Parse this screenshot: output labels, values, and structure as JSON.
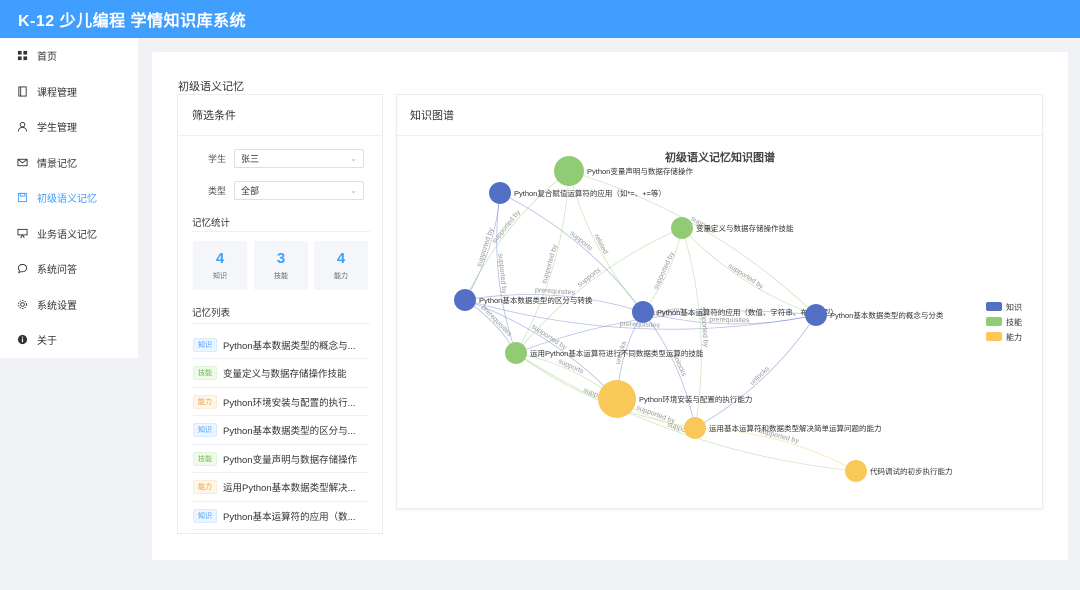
{
  "app": {
    "title": "K-12 少儿编程 学情知识库系统"
  },
  "sidebar": {
    "items": [
      {
        "label": "首页",
        "icon": "grid-icon"
      },
      {
        "label": "课程管理",
        "icon": "book-icon"
      },
      {
        "label": "学生管理",
        "icon": "user-icon"
      },
      {
        "label": "情景记忆",
        "icon": "mail-icon"
      },
      {
        "label": "初级语义记忆",
        "icon": "save-icon",
        "active": true
      },
      {
        "label": "业务语义记忆",
        "icon": "presentation-icon"
      },
      {
        "label": "系统问答",
        "icon": "chat-icon"
      },
      {
        "label": "系统设置",
        "icon": "gear-icon"
      },
      {
        "label": "关于",
        "icon": "info-icon"
      }
    ]
  },
  "page": {
    "title": "初级语义记忆"
  },
  "filter": {
    "header": "筛选条件",
    "student_label": "学生",
    "student_value": "张三",
    "type_label": "类型",
    "type_value": "全部",
    "stats_title": "记忆统计",
    "stats": [
      {
        "value": "4",
        "label": "知识"
      },
      {
        "value": "3",
        "label": "技能"
      },
      {
        "value": "4",
        "label": "能力"
      }
    ],
    "list_title": "记忆列表",
    "list": [
      {
        "tag": "知识",
        "kind": "k",
        "text": "Python基本数据类型的概念与..."
      },
      {
        "tag": "技能",
        "kind": "s",
        "text": "变量定义与数据存储操作技能"
      },
      {
        "tag": "能力",
        "kind": "a",
        "text": "Python环境安装与配置的执行..."
      },
      {
        "tag": "知识",
        "kind": "k",
        "text": "Python基本数据类型的区分与..."
      },
      {
        "tag": "技能",
        "kind": "s",
        "text": "Python变量声明与数据存储操作"
      },
      {
        "tag": "能力",
        "kind": "a",
        "text": "运用Python基本数据类型解决..."
      },
      {
        "tag": "知识",
        "kind": "k",
        "text": "Python基本运算符的应用（数..."
      }
    ]
  },
  "graph": {
    "header": "知识图谱",
    "title": "初级语义记忆知识图谱",
    "legend": [
      {
        "name": "知识",
        "color": "#5470c6"
      },
      {
        "name": "技能",
        "color": "#91cc75"
      },
      {
        "name": "能力",
        "color": "#fac858"
      }
    ],
    "nodes": [
      {
        "id": "n1",
        "label": "Python变量声明与数据存储操作",
        "cat": "技能"
      },
      {
        "id": "n2",
        "label": "Python复合赋值运算符的应用（如*=、+=等）",
        "cat": "知识"
      },
      {
        "id": "n3",
        "label": "变量定义与数据存储操作技能",
        "cat": "技能"
      },
      {
        "id": "n4",
        "label": "Python基本数据类型的区分与转换",
        "cat": "知识"
      },
      {
        "id": "n5",
        "label": "Python基本运算符的应用（数值、字符串、布尔类型）",
        "cat": "知识"
      },
      {
        "id": "n6",
        "label": "Python基本数据类型的概念与分类",
        "cat": "知识"
      },
      {
        "id": "n7",
        "label": "运用Python基本运算符进行不同数据类型运算的技能",
        "cat": "技能"
      },
      {
        "id": "n8",
        "label": "Python环境安装与配置的执行能力",
        "cat": "能力"
      },
      {
        "id": "n9",
        "label": "运用基本运算符和数据类型解决简单运算问题的能力",
        "cat": "能力"
      },
      {
        "id": "n10",
        "label": "代码调试的初步执行能力",
        "cat": "能力"
      }
    ],
    "edges": [
      {
        "s": "n2",
        "t": "n4",
        "label": "supported by"
      },
      {
        "s": "n2",
        "t": "n7",
        "label": "supported by"
      },
      {
        "s": "n2",
        "t": "n5",
        "label": "supports"
      },
      {
        "s": "n1",
        "t": "n5",
        "label": "related"
      },
      {
        "s": "n1",
        "t": "n7",
        "label": "supported by"
      },
      {
        "s": "n1",
        "t": "n4",
        "label": "supported by"
      },
      {
        "s": "n1",
        "t": "n6",
        "label": "supports"
      },
      {
        "s": "n3",
        "t": "n6",
        "label": "supported by"
      },
      {
        "s": "n3",
        "t": "n5",
        "label": "supported by"
      },
      {
        "s": "n3",
        "t": "n7",
        "label": "supports"
      },
      {
        "s": "n4",
        "t": "n5",
        "label": "prerequisites"
      },
      {
        "s": "n4",
        "t": "n6",
        "label": "prerequisites"
      },
      {
        "s": "n4",
        "t": "n7",
        "label": "prerequisites"
      },
      {
        "s": "n5",
        "t": "n6",
        "label": "prerequisites"
      },
      {
        "s": "n5",
        "t": "n9",
        "label": "unlocks"
      },
      {
        "s": "n5",
        "t": "n8",
        "label": "unlocks"
      },
      {
        "s": "n6",
        "t": "n9",
        "label": "unlocks"
      },
      {
        "s": "n6",
        "t": "n7",
        "label": "prerequisites"
      },
      {
        "s": "n7",
        "t": "n8",
        "label": "supports"
      },
      {
        "s": "n7",
        "t": "n9",
        "label": "supported by"
      },
      {
        "s": "n4",
        "t": "n8",
        "label": "supported by"
      },
      {
        "s": "n8",
        "t": "n9",
        "label": "supported by"
      },
      {
        "s": "n9",
        "t": "n10",
        "label": "supported by"
      },
      {
        "s": "n7",
        "t": "n10",
        "label": "supports"
      },
      {
        "s": "n3",
        "t": "n9",
        "label": "supported by"
      }
    ]
  }
}
